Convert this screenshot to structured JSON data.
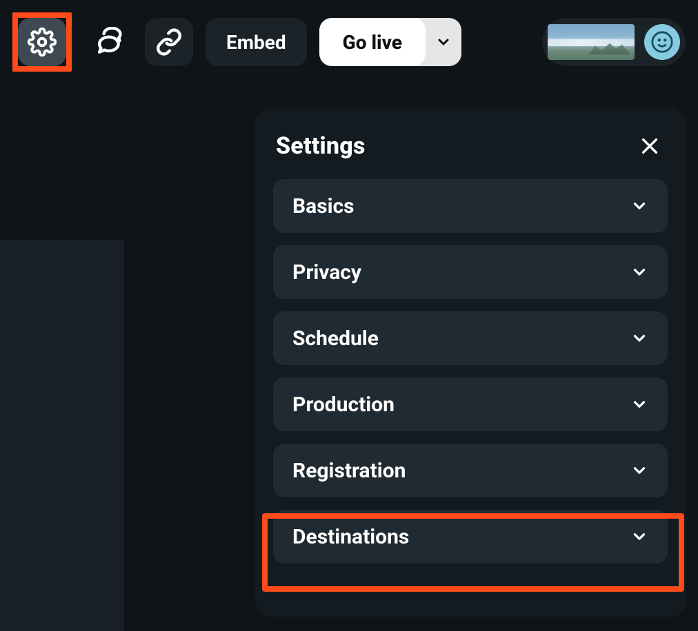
{
  "toolbar": {
    "embed_label": "Embed",
    "golive_label": "Go live"
  },
  "settings": {
    "title": "Settings",
    "items": [
      {
        "label": "Basics"
      },
      {
        "label": "Privacy"
      },
      {
        "label": "Schedule"
      },
      {
        "label": "Production"
      },
      {
        "label": "Registration"
      },
      {
        "label": "Destinations"
      }
    ]
  },
  "highlights": {
    "gear_button": true,
    "destinations_row": true
  }
}
